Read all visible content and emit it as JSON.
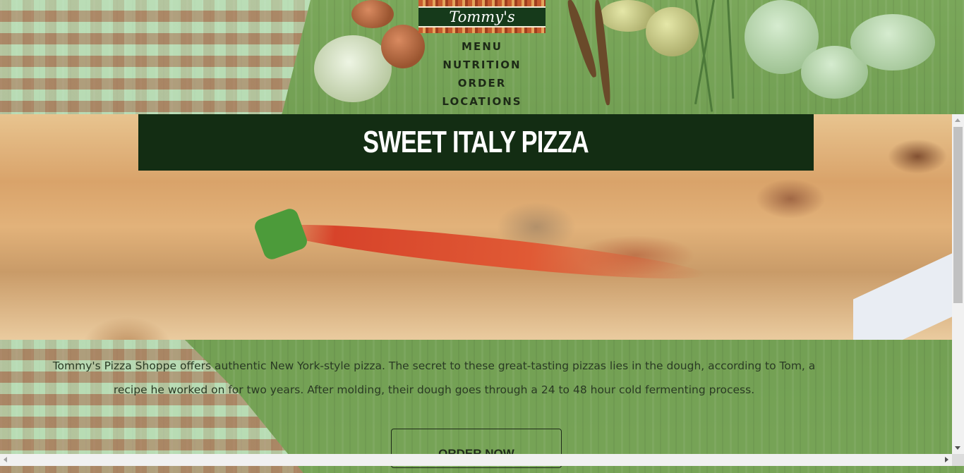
{
  "brand": {
    "logo_text": "Tommy's"
  },
  "nav": {
    "items": [
      {
        "label": "MENU"
      },
      {
        "label": "NUTRITION"
      },
      {
        "label": "ORDER"
      },
      {
        "label": "LOCATIONS"
      }
    ]
  },
  "hero": {
    "title": "SWEET ITALY PIZZA"
  },
  "intro": {
    "text": "Tommy's Pizza Shoppe offers authentic New York-style pizza. The secret to these great-tasting pizzas lies in the dough, according to Tom, a recipe he worked on for two years. After molding, their dough goes through a 24 to 48 hour cold fermenting process."
  },
  "cta": {
    "order_label": "ORDER NOW"
  },
  "colors": {
    "title_box": "#132d13",
    "background_green": "#6f9a4e",
    "nav_text": "#1d2a17"
  }
}
